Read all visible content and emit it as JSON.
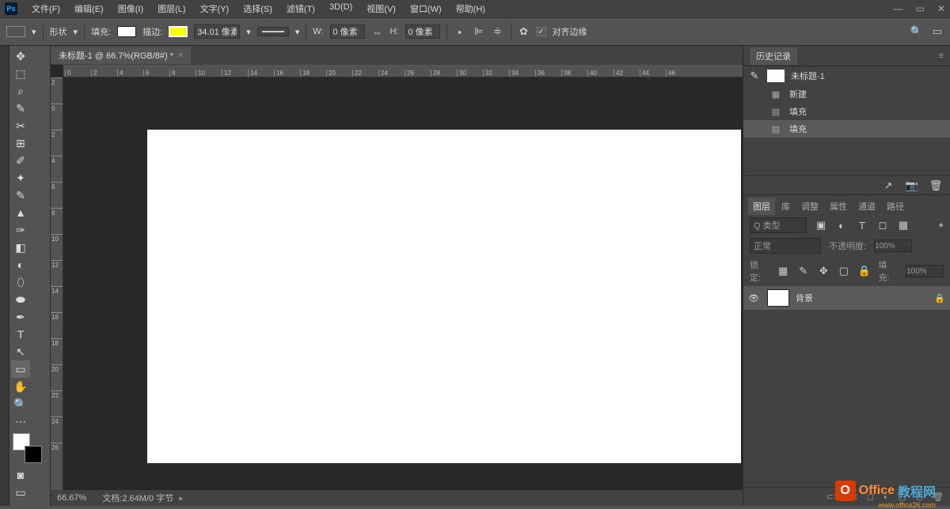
{
  "menu": [
    "文件(F)",
    "编辑(E)",
    "图像(I)",
    "图层(L)",
    "文字(Y)",
    "选择(S)",
    "滤镜(T)",
    "3D(D)",
    "视图(V)",
    "窗口(W)",
    "帮助(H)"
  ],
  "options": {
    "shape_label": "形状",
    "fill_label": "填充:",
    "stroke_label": "描边:",
    "stroke_width": "34.01 像素",
    "w_label": "W:",
    "w_val": "0 像素",
    "h_label": "H:",
    "h_val": "0 像素",
    "align_edges": "对齐边缘"
  },
  "doc_tab": "未标题-1 @ 66.7%(RGB/8#) *",
  "ruler_h": [
    "0",
    "2",
    "4",
    "6",
    "8",
    "10",
    "12",
    "14",
    "16",
    "18",
    "20",
    "22",
    "24",
    "26",
    "28",
    "30",
    "32",
    "34",
    "36",
    "38",
    "40",
    "42",
    "44",
    "46"
  ],
  "ruler_v": [
    "2",
    "0",
    "2",
    "4",
    "6",
    "8",
    "10",
    "12",
    "14",
    "16",
    "18",
    "20",
    "22",
    "24",
    "26"
  ],
  "status": {
    "zoom": "66.67%",
    "doc": "文档:2.64M/0 字节"
  },
  "history": {
    "title": "历史记录",
    "snapshot": "未标题-1",
    "items": [
      {
        "icon": "▦",
        "label": "新建"
      },
      {
        "icon": "▤",
        "label": "填充"
      },
      {
        "icon": "▤",
        "label": "填充"
      }
    ]
  },
  "layers_panel": {
    "tabs": [
      "图层",
      "库",
      "调整",
      "属性",
      "通道",
      "路径"
    ],
    "kind": "Q 类型",
    "blend": "正常",
    "opacity_label": "不透明度:",
    "opacity": "100%",
    "lock_label": "锁定:",
    "fill_label": "填充:",
    "fill": "100%",
    "layer": {
      "name": "背景"
    }
  },
  "watermark": {
    "t1": "Office",
    "t2": "教程网",
    "sub": "www.office26.com"
  }
}
